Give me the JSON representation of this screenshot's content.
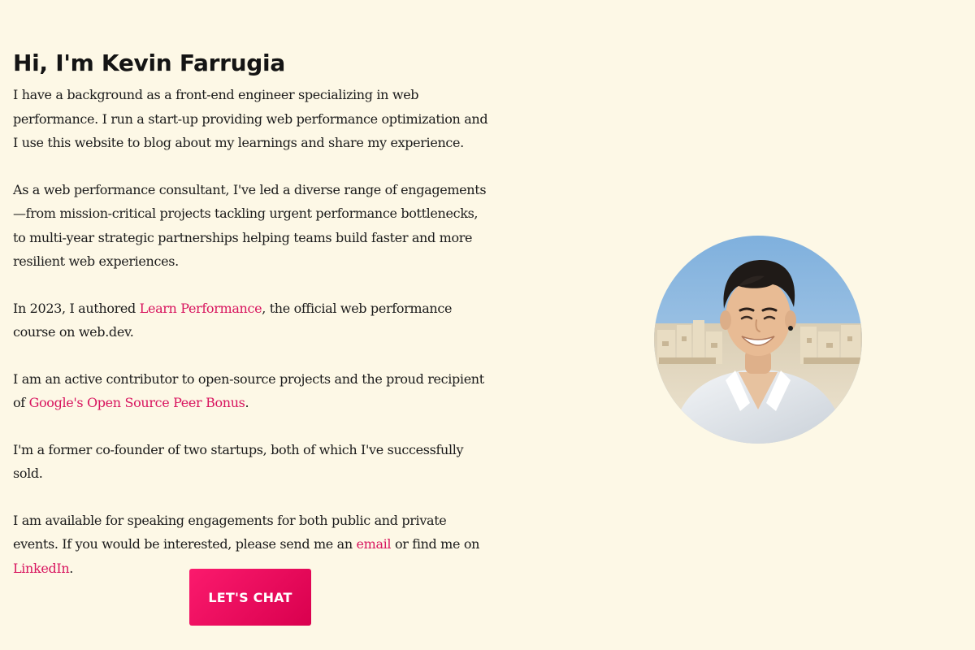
{
  "intro": {
    "heading": "Hi, I'm Kevin Farrugia",
    "p1": "I have a background as a front-end engineer specializing in web performance. I run a start-up providing web performance optimization and I use this website to blog about my learnings and share my experience.",
    "p2": "As a web performance consultant, I've led a diverse range of engagements—from mission-critical projects tackling urgent performance bottlenecks, to multi-year strategic partnerships helping teams build faster and more resilient web experiences.",
    "p3_before": "In 2023, I authored ",
    "p3_link": "Learn Performance",
    "p3_after": ", the official web performance course on web.dev.",
    "p4_before": "I am an active contributor to open-source projects and the proud recipient of ",
    "p4_link": "Google's Open Source Peer Bonus",
    "p4_after": ".",
    "p5": "I'm a former co-founder of two startups, both of which I've successfully sold.",
    "p6_before": "I am available for speaking engagements for both public and private events. If you would be interested, please send me an ",
    "p6_link_email": "email",
    "p6_middle": " or find me on ",
    "p6_link_linkedin": "LinkedIn",
    "p6_after": "."
  },
  "cta": {
    "label": "LET'S CHAT"
  },
  "colors": {
    "background": "#fdf8e6",
    "text": "#1b1b1b",
    "link": "#d8155f",
    "button_start": "#fb1a6d",
    "button_end": "#d9004e"
  }
}
